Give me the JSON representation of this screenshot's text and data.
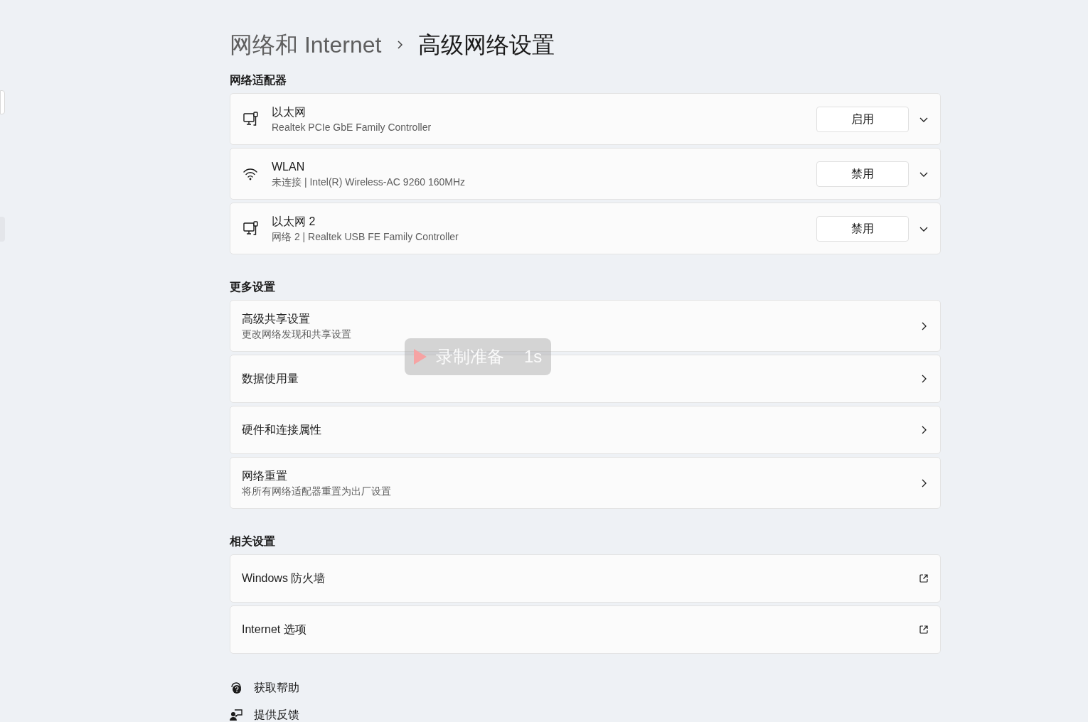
{
  "breadcrumb": [
    {
      "label": "网络和 Internet",
      "current": false
    },
    {
      "label": "高级网络设置",
      "current": true
    }
  ],
  "sections": [
    {
      "title": "网络适配器",
      "items": [
        {
          "kind": "ethernet",
          "title": "以太网",
          "subtitle": "Realtek PCIe GbE Family Controller",
          "button": "启用"
        },
        {
          "kind": "wifi",
          "title": "WLAN",
          "subtitle": "未连接 | Intel(R) Wireless-AC 9260 160MHz",
          "button": "禁用"
        },
        {
          "kind": "ethernet",
          "title": "以太网 2",
          "subtitle": "网络 2 | Realtek USB FE Family Controller",
          "button": "禁用"
        }
      ]
    },
    {
      "title": "更多设置",
      "items": [
        {
          "kind": "link",
          "title": "高级共享设置",
          "subtitle": "更改网络发现和共享设置"
        },
        {
          "kind": "link",
          "title": "数据使用量"
        },
        {
          "kind": "link",
          "title": "硬件和连接属性"
        },
        {
          "kind": "link",
          "title": "网络重置",
          "subtitle": "将所有网络适配器重置为出厂设置"
        }
      ]
    },
    {
      "title": "相关设置",
      "items": [
        {
          "kind": "external",
          "title": "Windows 防火墙"
        },
        {
          "kind": "external",
          "title": "Internet 选项"
        }
      ]
    }
  ],
  "footer_links": [
    {
      "kind": "help",
      "label": "获取帮助"
    },
    {
      "kind": "feedback",
      "label": "提供反馈"
    }
  ],
  "recording_overlay": {
    "label": "录制准备",
    "countdown": "1s"
  }
}
